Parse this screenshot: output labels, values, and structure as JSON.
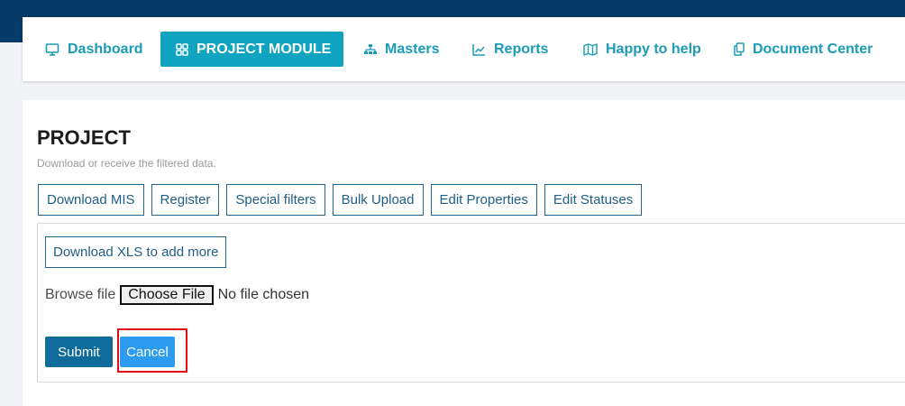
{
  "nav": {
    "items": [
      {
        "label": "Dashboard",
        "icon": "monitor-icon"
      },
      {
        "label": "PROJECT MODULE",
        "icon": "grid-icon"
      },
      {
        "label": "Masters",
        "icon": "sitemap-icon"
      },
      {
        "label": "Reports",
        "icon": "chart-line-icon"
      },
      {
        "label": "Happy to help",
        "icon": "map-icon"
      },
      {
        "label": "Document Center",
        "icon": "documents-icon"
      }
    ],
    "active": "PROJECT MODULE"
  },
  "page": {
    "title": "PROJECT",
    "subtitle": "Download or receive the filtered data."
  },
  "tabs": [
    "Download MIS",
    "Register",
    "Special filters",
    "Bulk Upload",
    "Edit Properties",
    "Edit Statuses"
  ],
  "bulk_upload": {
    "download_label": "Download XLS to add more",
    "browse_label": "Browse file",
    "choose_file_label": "Choose File",
    "no_file_text": "No file chosen",
    "submit_label": "Submit",
    "cancel_label": "Cancel"
  },
  "colors": {
    "topbar": "#073b68",
    "accent": "#10a4c0",
    "submit": "#0f6b9a",
    "cancel": "#2d9bf0",
    "highlight": "#e10b17"
  }
}
